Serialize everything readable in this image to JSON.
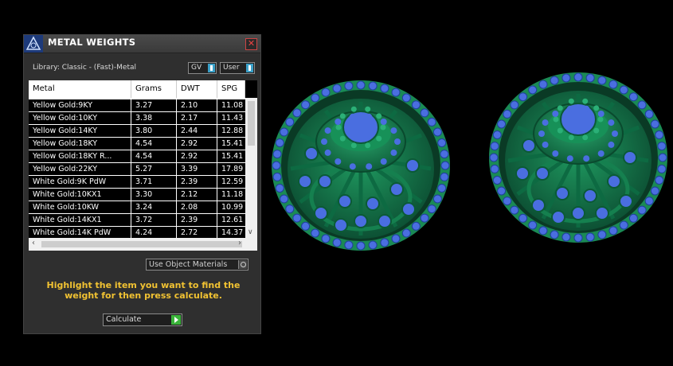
{
  "panel": {
    "title": "METAL WEIGHTS",
    "close_label": "✕",
    "library_label": "Library: Classic - (Fast)-Metal",
    "unit_dropdown": "GV",
    "user_dropdown": "User",
    "use_object_materials": "Use Object Materials",
    "message": "Highlight the item you want to find the weight for then press calculate.",
    "calculate_label": "Calculate"
  },
  "table": {
    "headers": [
      "Metal",
      "Grams",
      "DWT",
      "SPG"
    ],
    "rows": [
      [
        "Yellow Gold:9KY",
        "3.27",
        "2.10",
        "11.08"
      ],
      [
        "Yellow Gold:10KY",
        "3.38",
        "2.17",
        "11.43"
      ],
      [
        "Yellow Gold:14KY",
        "3.80",
        "2.44",
        "12.88"
      ],
      [
        "Yellow Gold:18KY",
        "4.54",
        "2.92",
        "15.41"
      ],
      [
        "Yellow Gold:18KY R...",
        "4.54",
        "2.92",
        "15.41"
      ],
      [
        "Yellow Gold:22KY",
        "5.27",
        "3.39",
        "17.89"
      ],
      [
        "White Gold:9K PdW",
        "3.71",
        "2.39",
        "12.59"
      ],
      [
        "White Gold:10KX1",
        "3.30",
        "2.12",
        "11.18"
      ],
      [
        "White Gold:10KW",
        "3.24",
        "2.08",
        "10.99"
      ],
      [
        "White Gold:14KX1",
        "3.72",
        "2.39",
        "12.61"
      ],
      [
        "White Gold:14K PdW",
        "4.24",
        "2.72",
        "14.37"
      ]
    ]
  },
  "colors": {
    "panel_bg": "#2f2f2f",
    "message_text": "#f1c232",
    "metal_green": "#1a8a55",
    "stone_blue": "#4a6ee0",
    "calc_button": "#3ab43a"
  }
}
